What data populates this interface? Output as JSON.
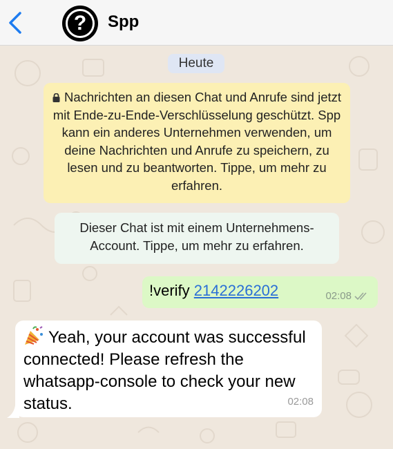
{
  "header": {
    "back_icon": "chevron-left-icon",
    "avatar_icon": "question-mark-icon",
    "contact_name": "Spp"
  },
  "chat": {
    "date_label": "Heute",
    "encryption_notice": "Nachrichten an diesen Chat und Anrufe sind jetzt mit Ende-zu-Ende-Verschlüsselung geschützt. Spp kann ein anderes Unternehmen verwenden, um deine Nachrichten und Anrufe zu speichern, zu lesen und zu beantworten. Tippe, um mehr zu erfahren.",
    "business_notice": "Dieser Chat ist mit einem Unternehmens-Account. Tippe, um mehr zu erfahren.",
    "outgoing": {
      "prefix": "!verify ",
      "number": "2142226202",
      "time": "02:08",
      "status_icon": "double-check-icon"
    },
    "incoming": {
      "emoji_icon": "party-popper-icon",
      "text": "Yeah, your account was successful connected! Please refresh the whatsapp-console to check your new status.",
      "time": "02:08"
    }
  },
  "colors": {
    "accent": "#1e7cf0",
    "outgoing_bubble": "#dcf8c6",
    "notice_bubble": "#fcf0b4",
    "wallpaper": "#efe7dd"
  }
}
